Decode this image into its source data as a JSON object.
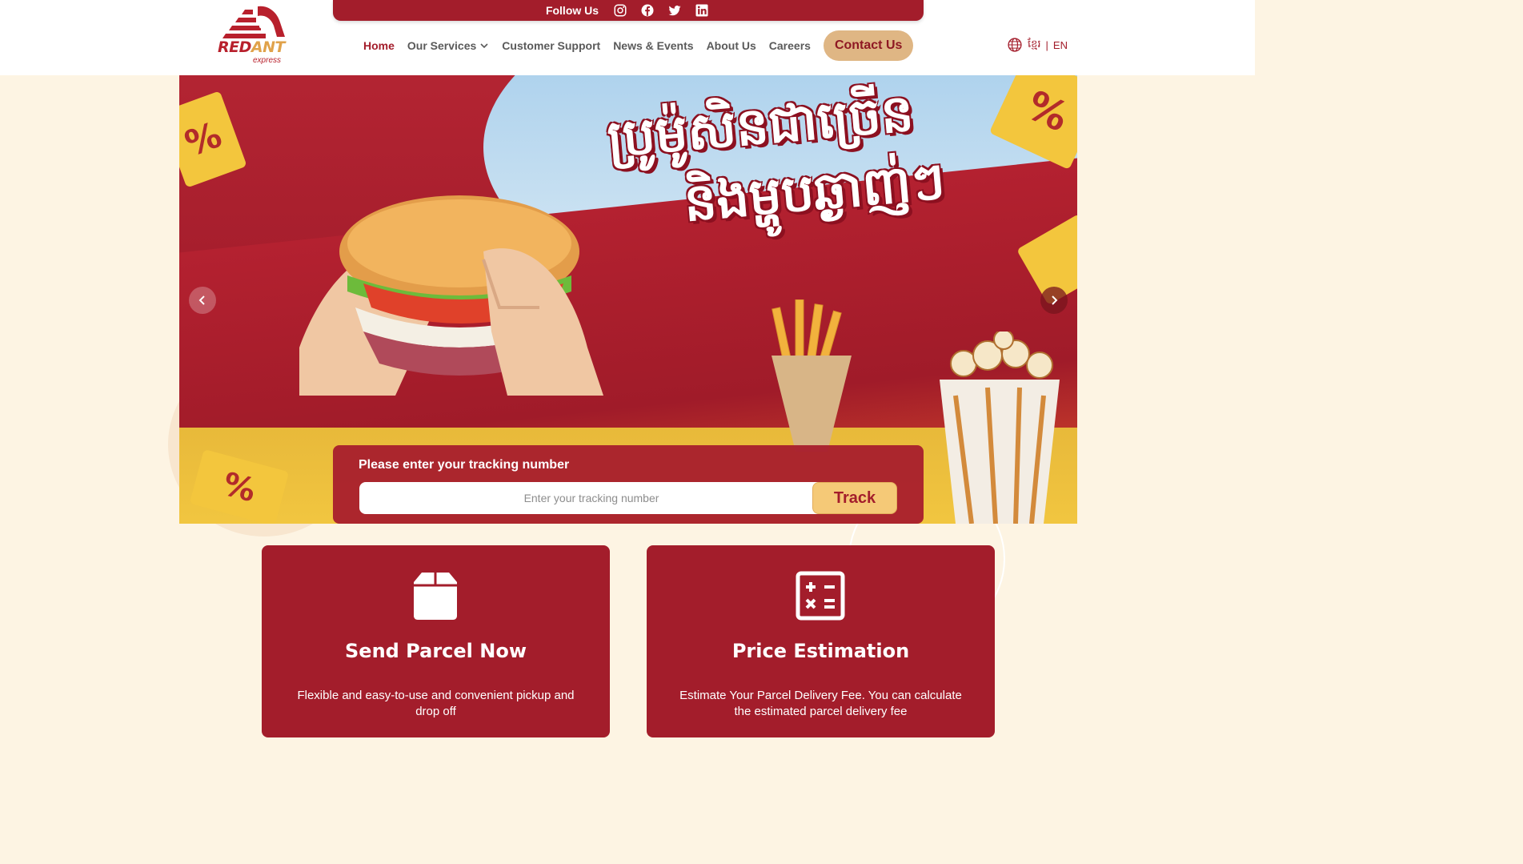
{
  "brand": {
    "name_red": "RED",
    "name_ant": "ANT",
    "tagline": "express"
  },
  "follow": {
    "label": "Follow Us",
    "icons": [
      "instagram-icon",
      "facebook-icon",
      "twitter-icon",
      "linkedin-icon"
    ]
  },
  "nav": {
    "items": [
      {
        "label": "Home",
        "active": true
      },
      {
        "label": "Our Services",
        "has_dropdown": true
      },
      {
        "label": "Customer Support"
      },
      {
        "label": "News & Events"
      },
      {
        "label": "About Us"
      },
      {
        "label": "Careers"
      }
    ],
    "contact_label": "Contact Us"
  },
  "language": {
    "km": "ខ្មែរ",
    "separator": "|",
    "en": "EN"
  },
  "hero": {
    "headline_line1": "ប្រូម៉ូសិនជាច្រើន",
    "headline_line2": "និងម្ហូបឆ្ងាញ់ៗ",
    "tag_symbol": "%"
  },
  "tracking": {
    "title": "Please enter your tracking number",
    "placeholder": "Enter your tracking number",
    "button": "Track"
  },
  "cards": [
    {
      "title": "Send Parcel Now",
      "description": "Flexible and easy-to-use and convenient pickup and drop off"
    },
    {
      "title": "Price Estimation",
      "description": "Estimate Your Parcel Delivery Fee. You can calculate the estimated parcel delivery fee"
    }
  ],
  "colors": {
    "primary": "#a31d2b",
    "accent": "#dfb684",
    "track_button": "#f5c977",
    "background": "#fdf4e3"
  }
}
